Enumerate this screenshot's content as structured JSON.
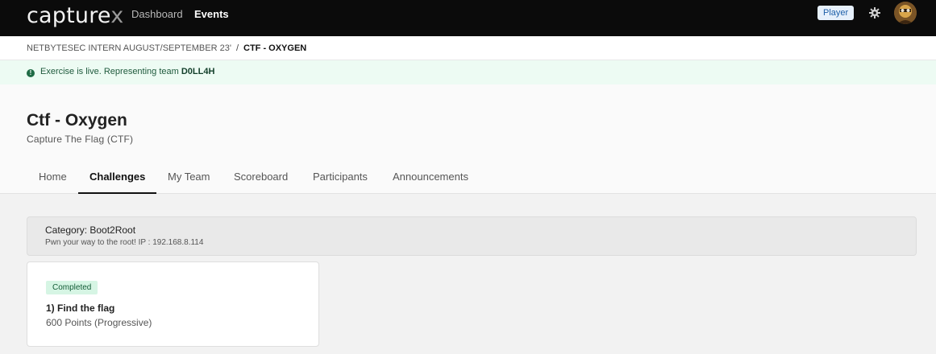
{
  "topbar": {
    "logo_main": "capture",
    "logo_x": "x",
    "nav": [
      {
        "label": "Dashboard"
      },
      {
        "label": "Events"
      }
    ],
    "role_badge": "Player",
    "icons": {
      "settings": "gear-icon",
      "profile": "avatar"
    }
  },
  "breadcrumb": {
    "parent": "NETBYTESEC INTERN AUGUST/SEPTEMBER 23'",
    "separator": "/",
    "current": "CTF - OXYGEN"
  },
  "alert": {
    "icon": "alert-info-icon",
    "text": "Exercise is live. Representing team ",
    "team": "D0LL4H"
  },
  "header": {
    "title": "Ctf - Oxygen",
    "subtitle": "Capture The Flag (CTF)"
  },
  "tabs": [
    {
      "label": "Home"
    },
    {
      "label": "Challenges"
    },
    {
      "label": "My Team"
    },
    {
      "label": "Scoreboard"
    },
    {
      "label": "Participants"
    },
    {
      "label": "Announcements"
    }
  ],
  "active_tab": "Challenges",
  "category": {
    "title": "Category: Boot2Root",
    "description": "Pwn your way to the root! IP : 192.168.8.114"
  },
  "challenges": [
    {
      "status": "Completed",
      "title": "1) Find the flag",
      "points": "600 Points (Progressive)"
    }
  ],
  "colors": {
    "topbar_bg": "#0b0b0b",
    "alert_bg": "#edfbf3",
    "completed_badge_bg": "#d6f5e4",
    "player_badge_bg": "#e6f0fb"
  }
}
